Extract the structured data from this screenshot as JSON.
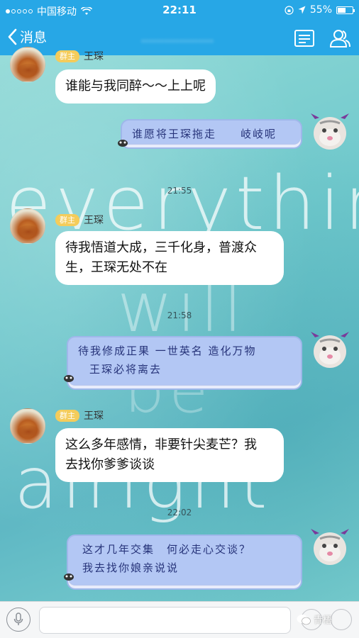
{
  "status_bar": {
    "carrier": "中国移动",
    "time": "22:11",
    "battery_percent": "55%",
    "battery_level": 0.55
  },
  "nav": {
    "back_label": "消息",
    "title": "...................",
    "accent": "#27a7e6"
  },
  "wallpaper": {
    "words": [
      "everything",
      "will",
      "be",
      "alright"
    ]
  },
  "messages": [
    {
      "side": "left",
      "text": "谁能与我同醉～～上上呢"
    },
    {
      "side": "right",
      "text": "谁愿将王琛拖走　　岐岐呢"
    },
    {
      "time": "21:55"
    },
    {
      "side": "left",
      "badge": "群主",
      "name": "王琛",
      "text": "待我悟道大成，三千化身，普渡众生，王琛无处不在"
    },
    {
      "time": "21:58"
    },
    {
      "side": "right",
      "text": "待我修成正果 一世英名 造化万物 王琛必将离去"
    },
    {
      "side": "left",
      "badge": "群主",
      "name": "王琛",
      "text": "这么多年感情，非要针尖麦芒？我去找你爹爹谈谈"
    },
    {
      "time": "22:02"
    },
    {
      "side": "right",
      "text": "这才几年交集　何必走心交谈？ 我去找你娘亲说说"
    }
  ],
  "first_sender": {
    "badge": "群主",
    "name": "王琛"
  },
  "display": {
    "msg1": "谁能与我同醉～～上上呢",
    "msg2": "谁愿将王琛拖走　　岐岐呢",
    "time1": "21:55",
    "msg3_line1": "待我悟道大成，三千化身，普渡众",
    "msg3_line2": "生，王琛无处不在",
    "time2": "21:58",
    "msg4_line1": "待我修成正果 一世英名 造化万物",
    "msg4_line2": "王琛必将离去",
    "msg5_line1": "这么多年感情，非要针尖麦芒？我",
    "msg5_line2": "去找你爹爹谈谈",
    "time3": "22:02",
    "msg6_line1": "这才几年交集　何必走心交谈？",
    "msg6_line2": "我去找你娘亲说说"
  },
  "input_bar": {
    "placeholder": ""
  },
  "watermark": "青梧"
}
